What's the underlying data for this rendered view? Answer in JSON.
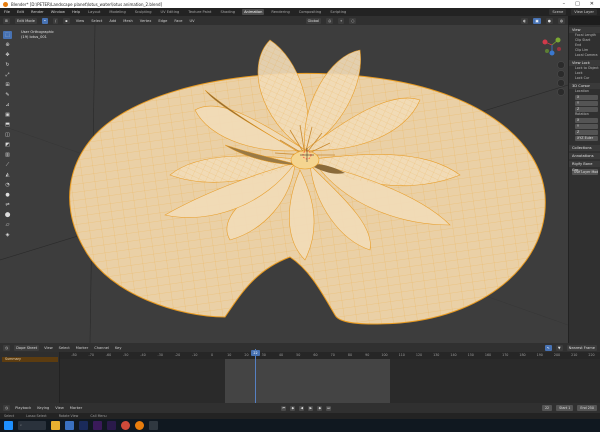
{
  "window": {
    "title": "Blender* [D:\\PETER\\Landscape planet\\lotus_water\\lotus animation_2.blend]"
  },
  "menu": {
    "items": [
      "File",
      "Edit",
      "Render",
      "Window",
      "Help"
    ],
    "workspaces": [
      "Layout",
      "Modeling",
      "Sculpting",
      "UV Editing",
      "Texture Paint",
      "Shading",
      "Animation",
      "Rendering",
      "Compositing",
      "Scripting"
    ],
    "active_workspace": "Animation",
    "scene_name": "Scene",
    "view_layer": "View Layer"
  },
  "viewport_header": {
    "mode": "Edit Mode",
    "menus": [
      "View",
      "Select",
      "Add",
      "Mesh",
      "Vertex",
      "Edge",
      "Face",
      "UV"
    ],
    "transform": "Global"
  },
  "viewport": {
    "info_line1": "User Orthographic",
    "info_line2": "(19) lotus_001"
  },
  "toolbar": {
    "tools": [
      "select-box-icon",
      "cursor-icon",
      "move-icon",
      "rotate-icon",
      "scale-icon",
      "transform-icon",
      "annotate-icon",
      "measure-icon",
      "add-cube-icon",
      "extrude-icon",
      "inset-icon",
      "bevel-icon",
      "loop-cut-icon",
      "knife-icon",
      "poly-build-icon",
      "spin-icon",
      "smooth-icon",
      "edge-slide-icon",
      "shrink-icon",
      "shear-icon",
      "rip-icon"
    ]
  },
  "sidebar": {
    "view_header": "View",
    "view_lines": [
      "Focal Length",
      "Clip Start",
      "End",
      "Clip Lim"
    ],
    "local_camera": "Local Camera",
    "view_lock_header": "View Lock",
    "lock_lines": [
      "Lock to Object",
      "Lock",
      "Lock Cur"
    ],
    "cursor_header": "3D Cursor",
    "location_label": "Location",
    "rotation_label": "Rotation",
    "xyz": [
      "X",
      "Y",
      "Z"
    ],
    "rotation_mode": "XYZ Euler",
    "collections_header": "Collections",
    "annotations_header": "Annotations",
    "rigify_header": "Rigify Bone Gro...",
    "rigify_button": "Use Layer Mode Per..."
  },
  "timeline_header": {
    "editor": "Dope Sheet",
    "menus": [
      "View",
      "Select",
      "Marker",
      "Channel",
      "Key"
    ],
    "search": "Nearest Frame"
  },
  "timeline": {
    "ruler_labels": [
      "-80",
      "-70",
      "-60",
      "-50",
      "-40",
      "-30",
      "-20",
      "-10",
      "0",
      "10",
      "20",
      "30",
      "40",
      "50",
      "60",
      "70",
      "80",
      "90",
      "100",
      "110",
      "120",
      "130",
      "140",
      "150",
      "160",
      "170",
      "180",
      "190",
      "200",
      "210",
      "220"
    ],
    "current_frame": "22",
    "summary_label": "Summary",
    "frame_start": 0,
    "frame_end": 100
  },
  "playback": {
    "playback_label": "Playback",
    "keying_label": "Keying",
    "view_label": "View",
    "marker_label": "Marker",
    "current_frame_field": "22",
    "start_label": "Start",
    "start_value": "1",
    "end_label": "End",
    "end_value": "250"
  },
  "statusbar": {
    "select": "Select",
    "lasso": "Lasso Select",
    "rotate": "Rotate View",
    "menu": "Call Menu"
  },
  "colors": {
    "accent": "#4772b3",
    "mesh_fill": "#e8c9a0",
    "mesh_wire": "#f0a020",
    "summary": "#5c3c10"
  }
}
